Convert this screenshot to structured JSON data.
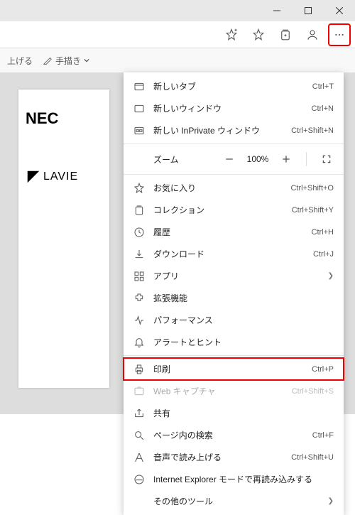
{
  "titlebar": {
    "min": "−",
    "max": "□",
    "close": "✕"
  },
  "subbar": {
    "item1": "上げる",
    "item2": "手描き",
    "chevron": "›"
  },
  "logos": {
    "nec": "NEC",
    "lavie": "LAVIE"
  },
  "zoom": {
    "label": "ズーム",
    "value": "100%"
  },
  "menu": {
    "new_tab": {
      "label": "新しいタブ",
      "shortcut": "Ctrl+T"
    },
    "new_window": {
      "label": "新しいウィンドウ",
      "shortcut": "Ctrl+N"
    },
    "new_inprivate": {
      "label": "新しい InPrivate ウィンドウ",
      "shortcut": "Ctrl+Shift+N"
    },
    "favorites": {
      "label": "お気に入り",
      "shortcut": "Ctrl+Shift+O"
    },
    "collections": {
      "label": "コレクション",
      "shortcut": "Ctrl+Shift+Y"
    },
    "history": {
      "label": "履歴",
      "shortcut": "Ctrl+H"
    },
    "downloads": {
      "label": "ダウンロード",
      "shortcut": "Ctrl+J"
    },
    "apps": {
      "label": "アプリ"
    },
    "extensions": {
      "label": "拡張機能"
    },
    "performance": {
      "label": "パフォーマンス"
    },
    "alerts": {
      "label": "アラートとヒント"
    },
    "print": {
      "label": "印刷",
      "shortcut": "Ctrl+P"
    },
    "web_capture": {
      "label": "Web キャプチャ",
      "shortcut": "Ctrl+Shift+S"
    },
    "share": {
      "label": "共有"
    },
    "find": {
      "label": "ページ内の検索",
      "shortcut": "Ctrl+F"
    },
    "read_aloud": {
      "label": "音声で読み上げる",
      "shortcut": "Ctrl+Shift+U"
    },
    "ie_mode": {
      "label": "Internet Explorer モードで再読み込みする"
    },
    "more_tools": {
      "label": "その他のツール"
    }
  }
}
